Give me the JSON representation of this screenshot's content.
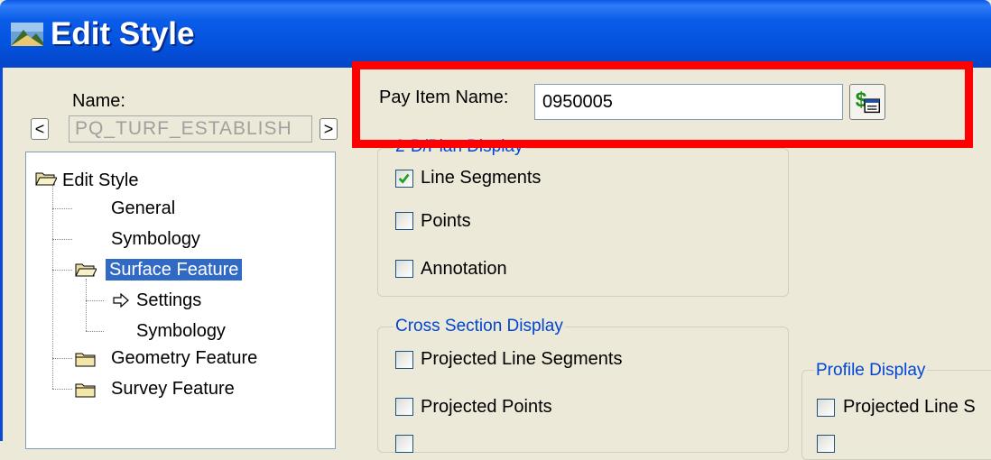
{
  "window": {
    "title": "Edit Style"
  },
  "name_section": {
    "label": "Name:",
    "value": "PQ_TURF_ESTABLISH",
    "prev_glyph": "<",
    "next_glyph": ">"
  },
  "tree": {
    "root": "Edit Style",
    "items": [
      {
        "label": "General"
      },
      {
        "label": "Symbology"
      },
      {
        "label": "Surface Feature"
      },
      {
        "label": "Settings"
      },
      {
        "label": "Symbology"
      },
      {
        "label": "Geometry Feature"
      },
      {
        "label": "Survey Feature"
      }
    ]
  },
  "pay_item": {
    "label": "Pay Item Name:",
    "value": "0950005"
  },
  "plan_display": {
    "title": "2-D/Plan Display",
    "options": [
      {
        "label": "Line Segments",
        "checked": true
      },
      {
        "label": "Points",
        "checked": false
      },
      {
        "label": "Annotation",
        "checked": false
      }
    ]
  },
  "cross_section": {
    "title": "Cross Section Display",
    "options": [
      {
        "label": "Projected Line Segments",
        "checked": false
      },
      {
        "label": "Projected Points",
        "checked": false
      }
    ]
  },
  "profile": {
    "title": "Profile Display",
    "options": [
      {
        "label": "Projected Line S",
        "checked": false
      }
    ]
  },
  "colors": {
    "title_bar": "#0554e0",
    "selection": "#316ac5",
    "highlight_box": "#ff0000",
    "group_title": "#0046d5"
  }
}
